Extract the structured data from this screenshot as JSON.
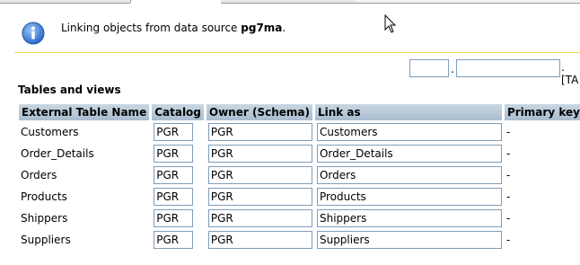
{
  "message": {
    "prefix": "Linking objects from data source",
    "source": "pg7ma",
    "suffix": "."
  },
  "top_fields": {
    "dot1": ".",
    "tail": ".[TA"
  },
  "section_title": "Tables and views",
  "columns": [
    "External Table Name",
    "Catalog",
    "Owner (Schema)",
    "Link as",
    "Primary key(s)"
  ],
  "rows": [
    {
      "name": "Customers",
      "catalog": "PGR",
      "owner": "PGR",
      "link_as": "Customers",
      "pk": "-"
    },
    {
      "name": "Order_Details",
      "catalog": "PGR",
      "owner": "PGR",
      "link_as": "Order_Details",
      "pk": "-"
    },
    {
      "name": "Orders",
      "catalog": "PGR",
      "owner": "PGR",
      "link_as": "Orders",
      "pk": "-"
    },
    {
      "name": "Products",
      "catalog": "PGR",
      "owner": "PGR",
      "link_as": "Products",
      "pk": "-"
    },
    {
      "name": "Shippers",
      "catalog": "PGR",
      "owner": "PGR",
      "link_as": "Shippers",
      "pk": "-"
    },
    {
      "name": "Suppliers",
      "catalog": "PGR",
      "owner": "PGR",
      "link_as": "Suppliers",
      "pk": "-"
    }
  ],
  "icons": {
    "info": "info-icon",
    "cursor": "mouse-pointer-icon"
  },
  "colors": {
    "header_bg": "#b0c4d8",
    "input_border": "#7f9db9",
    "info_blue": "#3a7bd5",
    "msg_border": "#e2e24a"
  }
}
